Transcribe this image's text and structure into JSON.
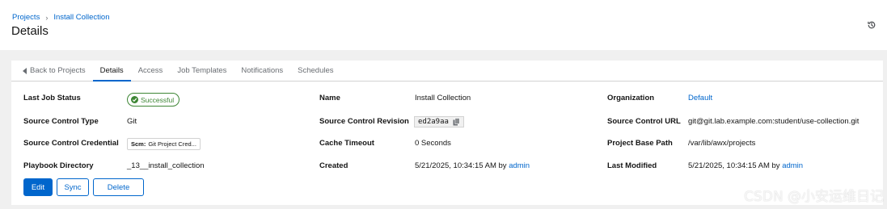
{
  "header": {
    "breadcrumb": [
      "Projects",
      "Install Collection"
    ],
    "breadcrumb_separator": "›",
    "title": "Details",
    "history_icon": "history-icon"
  },
  "tabs": [
    {
      "label": "Back to Projects",
      "icon": "caret-left-icon"
    },
    {
      "label": "Details",
      "active": true
    },
    {
      "label": "Access"
    },
    {
      "label": "Job Templates"
    },
    {
      "label": "Notifications"
    },
    {
      "label": "Schedules"
    }
  ],
  "details": {
    "last_job_status": {
      "label": "Last Job Status",
      "value": "Successful"
    },
    "name": {
      "label": "Name",
      "value": "Install Collection"
    },
    "organization": {
      "label": "Organization",
      "value": "Default"
    },
    "source_control_type": {
      "label": "Source Control Type",
      "value": "Git"
    },
    "source_control_revision": {
      "label": "Source Control Revision",
      "value": "ed2a9aa"
    },
    "source_control_url": {
      "label": "Source Control URL",
      "value": "git@git.lab.example.com:student/use-collection.git"
    },
    "source_control_credential": {
      "label": "Source Control Credential",
      "prefix": "Scm:",
      "value": "Git Project Cred..."
    },
    "cache_timeout": {
      "label": "Cache Timeout",
      "value": "0 Seconds"
    },
    "project_base_path": {
      "label": "Project Base Path",
      "value": "/var/lib/awx/projects"
    },
    "playbook_directory": {
      "label": "Playbook Directory",
      "value": "_13__install_collection"
    },
    "created": {
      "label": "Created",
      "value": "5/21/2025, 10:34:15 AM by",
      "user": "admin"
    },
    "last_modified": {
      "label": "Last Modified",
      "value": "5/21/2025, 10:34:15 AM by",
      "user": "admin"
    }
  },
  "actions": {
    "edit": "Edit",
    "sync": "Sync",
    "delete": "Delete"
  },
  "watermark": "CSDN @小安运维日记",
  "colors": {
    "primary": "#0066cc",
    "success": "#3e8635",
    "page_bg": "#f0f0f0"
  }
}
